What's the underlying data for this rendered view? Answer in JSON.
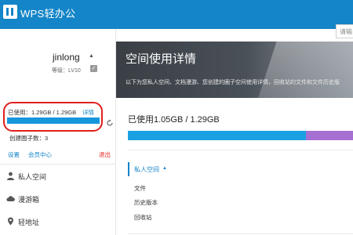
{
  "app": {
    "title": "WPS轻办公"
  },
  "search": {
    "placeholder": "请输"
  },
  "user": {
    "name": "jinlong",
    "level": "等级：LV10"
  },
  "storage": {
    "used_label": "已使用：1.29GB / 1.29GB",
    "detail_link": "详情",
    "used_fraction": 1.0
  },
  "circles": {
    "count_label": "创建圈子数：3"
  },
  "links": {
    "settings": "设置",
    "member": "会员中心",
    "logout": "退出"
  },
  "nav": [
    {
      "label": "私人空间",
      "icon": "person-icon"
    },
    {
      "label": "漫游箱",
      "icon": "cloud-icon"
    },
    {
      "label": "轻地址",
      "icon": "location-pin-icon"
    }
  ],
  "banner": {
    "title": "空间使用详情",
    "subtitle": "以下为您私人空间、文档漫游、您创建的圈子空间使用详情，回收站的文件和文件历史版"
  },
  "main": {
    "used_total": "已使用1.05GB / 1.29GB",
    "bar_segments": [
      {
        "name": "used",
        "fraction": 0.79,
        "color": "#1ba1e2"
      },
      {
        "name": "other",
        "fraction": 0.21,
        "color": "#a670d3"
      }
    ],
    "tree": {
      "header": "私人空间",
      "items": [
        "文件",
        "历史版本",
        "回收站"
      ]
    }
  },
  "colors": {
    "brand": "#1485c8",
    "highlight": "#e0201e",
    "banner_dark": "#3a3f45"
  }
}
